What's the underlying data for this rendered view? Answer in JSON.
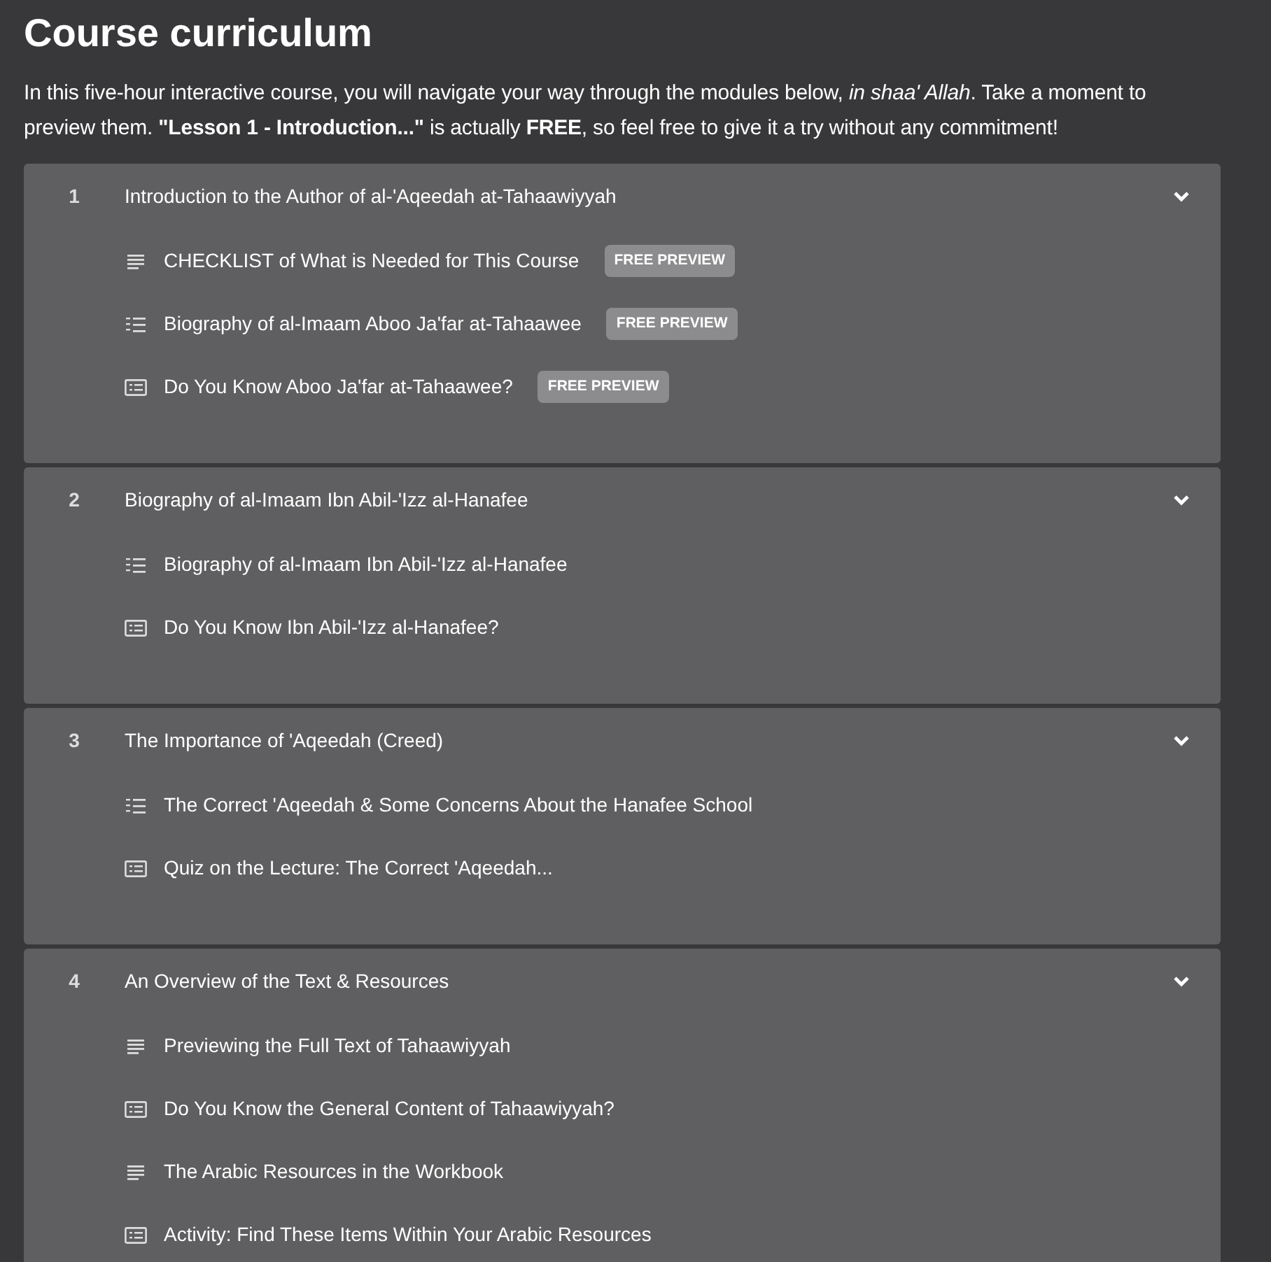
{
  "heading": "Course curriculum",
  "intro": "In this five-hour interactive course, you will navigate your way through the modules below, *in shaa' Allah*. Take a moment to preview them. **\"Lesson 1 - Introduction...\"** is actually **FREE**, so feel free to give it a try without any commitment!",
  "sections": [
    {
      "number": "1",
      "title": "Introduction to the Author of al-'Aqeedah at-Tahaawiyyah",
      "expanded": true,
      "lessons": [
        {
          "kind": "text",
          "title": "CHECKLIST of What is Needed for This Course",
          "badge": "FREE PREVIEW"
        },
        {
          "kind": "list",
          "title": "Biography of al-Imaam Aboo Ja'far at-Tahaawee",
          "badge": "FREE PREVIEW"
        },
        {
          "kind": "quiz",
          "title": "Do You Know Aboo Ja'far at-Tahaawee?",
          "badge": "FREE PREVIEW"
        }
      ]
    },
    {
      "number": "2",
      "title": "Biography of al-Imaam Ibn Abil-'Izz al-Hanafee",
      "expanded": true,
      "lessons": [
        {
          "kind": "list",
          "title": "Biography of al-Imaam Ibn Abil-'Izz al-Hanafee"
        },
        {
          "kind": "quiz",
          "title": "Do You Know Ibn Abil-'Izz al-Hanafee?"
        }
      ]
    },
    {
      "number": "3",
      "title": "The Importance of 'Aqeedah (Creed)",
      "expanded": true,
      "lessons": [
        {
          "kind": "list",
          "title": "The Correct 'Aqeedah & Some Concerns About the Hanafee School"
        },
        {
          "kind": "quiz",
          "title": "Quiz on the Lecture: The Correct 'Aqeedah..."
        }
      ]
    },
    {
      "number": "4",
      "title": "An Overview of the Text & Resources",
      "expanded": true,
      "lessons": [
        {
          "kind": "text",
          "title": "Previewing the Full Text of Tahaawiyyah"
        },
        {
          "kind": "quiz",
          "title": "Do You Know the General Content of Tahaawiyyah?"
        },
        {
          "kind": "text",
          "title": "The Arabic Resources in the Workbook"
        },
        {
          "kind": "quiz",
          "title": "Activity: Find These Items Within Your Arabic Resources"
        }
      ]
    }
  ]
}
